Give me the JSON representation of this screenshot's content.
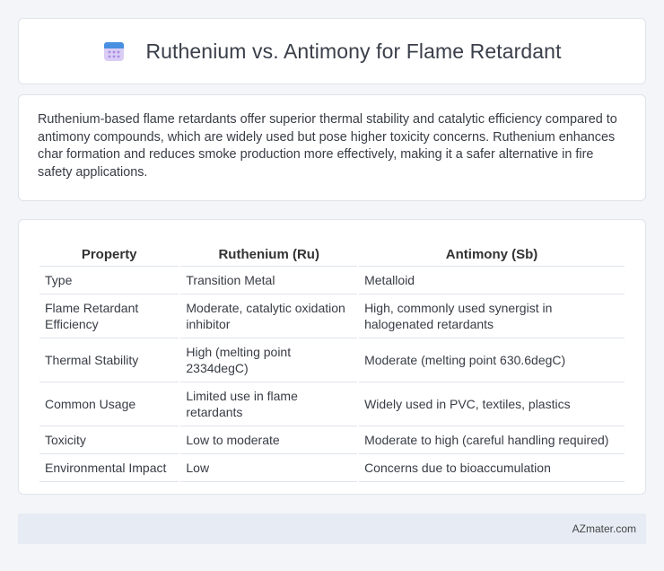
{
  "header": {
    "title": "Ruthenium vs. Antimony for Flame Retardant",
    "icon": "calendar-icon"
  },
  "summary": {
    "text": "Ruthenium-based flame retardants offer superior thermal stability and catalytic efficiency compared to antimony compounds, which are widely used but pose higher toxicity concerns. Ruthenium enhances char formation and reduces smoke production more effectively, making it a safer alternative in fire safety applications."
  },
  "table": {
    "headers": [
      "Property",
      "Ruthenium (Ru)",
      "Antimony (Sb)"
    ],
    "rows": [
      [
        "Type",
        "Transition Metal",
        "Metalloid"
      ],
      [
        "Flame Retardant Efficiency",
        "Moderate, catalytic oxidation inhibitor",
        "High, commonly used synergist in halogenated retardants"
      ],
      [
        "Thermal Stability",
        "High (melting point 2334degC)",
        "Moderate (melting point 630.6degC)"
      ],
      [
        "Common Usage",
        "Limited use in flame retardants",
        "Widely used in PVC, textiles, plastics"
      ],
      [
        "Toxicity",
        "Low to moderate",
        "Moderate to high (careful handling required)"
      ],
      [
        "Environmental Impact",
        "Low",
        "Concerns due to bioaccumulation"
      ]
    ]
  },
  "footer": {
    "text": "AZmater.com"
  },
  "colors": {
    "background": "#f3f5f9",
    "card": "#ffffff",
    "footer": "#e6ebf4",
    "icon_top": "#4a90e2",
    "icon_body": "#c9b8f0"
  }
}
